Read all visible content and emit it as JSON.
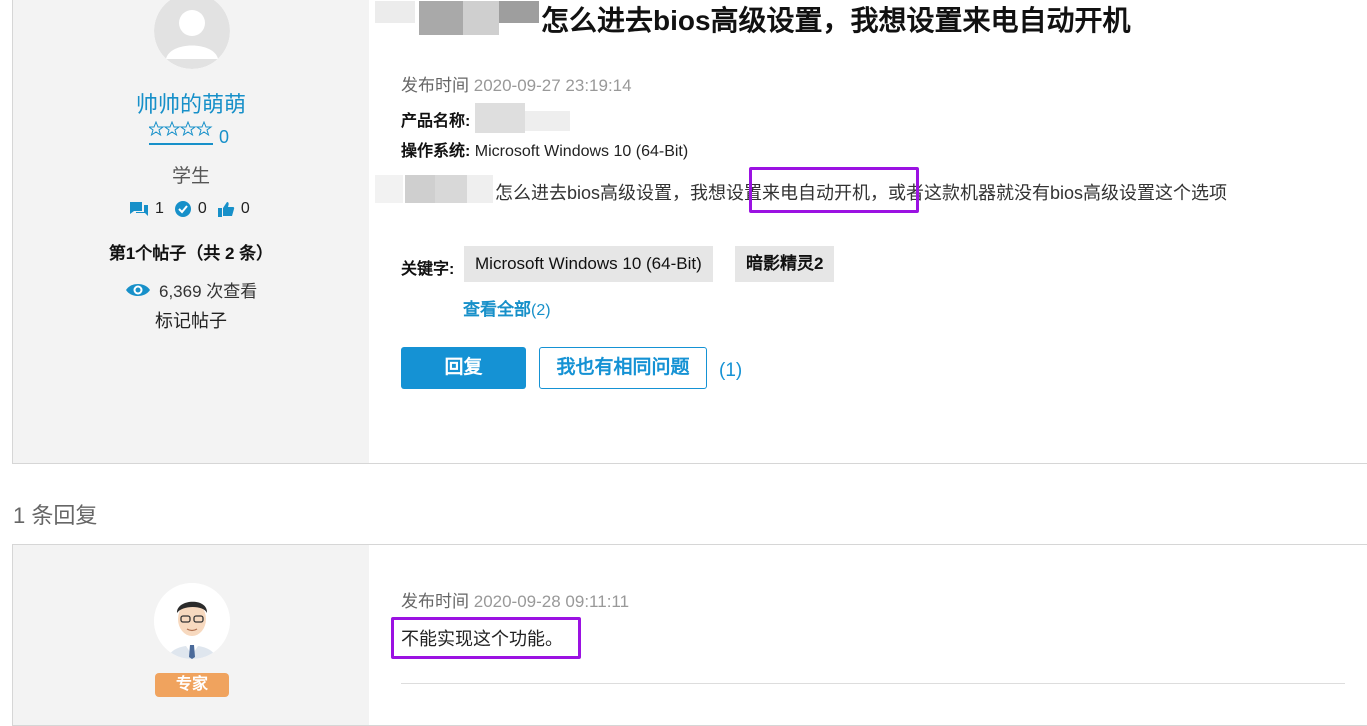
{
  "question": {
    "author": {
      "name": "帅帅的萌萌",
      "star_count": "0",
      "role": "学生",
      "messages": "1",
      "solutions": "0",
      "kudos": "0",
      "post_position": "第1个帖子（共 2 条）",
      "views": "6,369 次查看",
      "bookmark": "标记帖子"
    },
    "title": "怎么进去bios高级设置，我想设置来电自动开机",
    "published_label": "发布时间",
    "published_time": "2020-09-27 23:19:14",
    "product_label": "产品名称:",
    "os_label": "操作系统:",
    "os_value": "Microsoft Windows 10 (64-Bit)",
    "body": "怎么进去bios高级设置，我想设置来电自动开机，或者这款机器就没有bios高级设置这个选项",
    "keywords_label": "关键字:",
    "tags": [
      "Microsoft Windows 10 (64-Bit)",
      "暗影精灵2"
    ],
    "view_all_label": "查看全部",
    "view_all_count": "(2)",
    "reply_button": "回复",
    "same_question_button": "我也有相同问题",
    "same_question_count": "(1)"
  },
  "replies_header": "1 条回复",
  "reply": {
    "badge": "专家",
    "published_label": "发布时间",
    "published_time": "2020-09-28 09:11:11",
    "body": "不能实现这个功能。"
  },
  "colors": {
    "accent": "#1592d4",
    "highlight_box": "#9b12e2",
    "expert_badge": "#f0a35e"
  },
  "icons": [
    "default-avatar-icon",
    "star-icon",
    "message-icon",
    "check-circle-icon",
    "thumbs-up-icon",
    "eye-icon",
    "expert-avatar"
  ]
}
